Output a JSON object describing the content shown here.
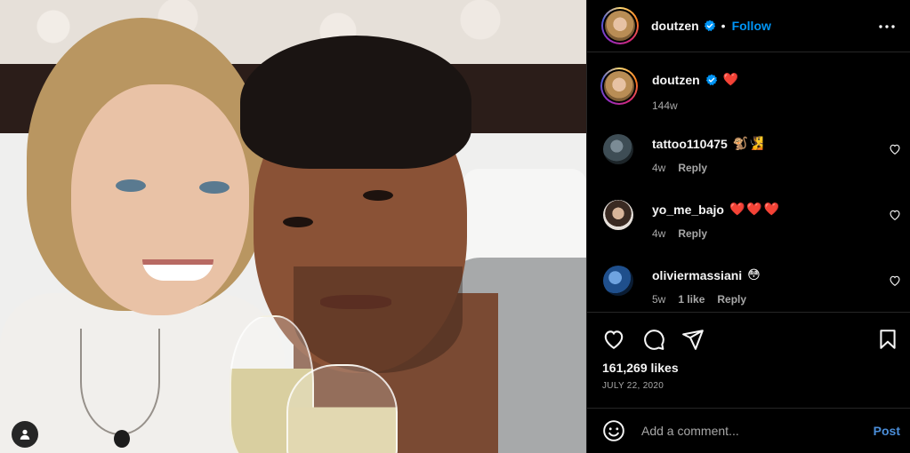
{
  "post": {
    "author": "doutzen",
    "follow_label": "Follow",
    "separator": "•",
    "caption": "❤️",
    "caption_time": "144w",
    "likes": "161,269 likes",
    "date": "JULY 22, 2020"
  },
  "comments": [
    {
      "user": "tattoo110475",
      "text": "🐒🧏",
      "time": "4w",
      "likes": "",
      "reply": "Reply"
    },
    {
      "user": "yo_me_bajo",
      "text": "❤️❤️❤️",
      "time": "4w",
      "likes": "",
      "reply": "Reply"
    },
    {
      "user": "oliviermassiani",
      "text": "😳",
      "time": "5w",
      "likes": "1 like",
      "reply": "Reply"
    }
  ],
  "composer": {
    "placeholder": "Add a comment...",
    "post_label": "Post"
  },
  "colors": {
    "accent": "#0095f6",
    "heart": "#ed4956",
    "secondary_text": "#a8a8a8"
  },
  "icons": [
    "user-tag-icon",
    "more-icon",
    "verified-icon",
    "heart-icon",
    "comment-icon",
    "share-icon",
    "bookmark-icon",
    "emoji-icon"
  ]
}
